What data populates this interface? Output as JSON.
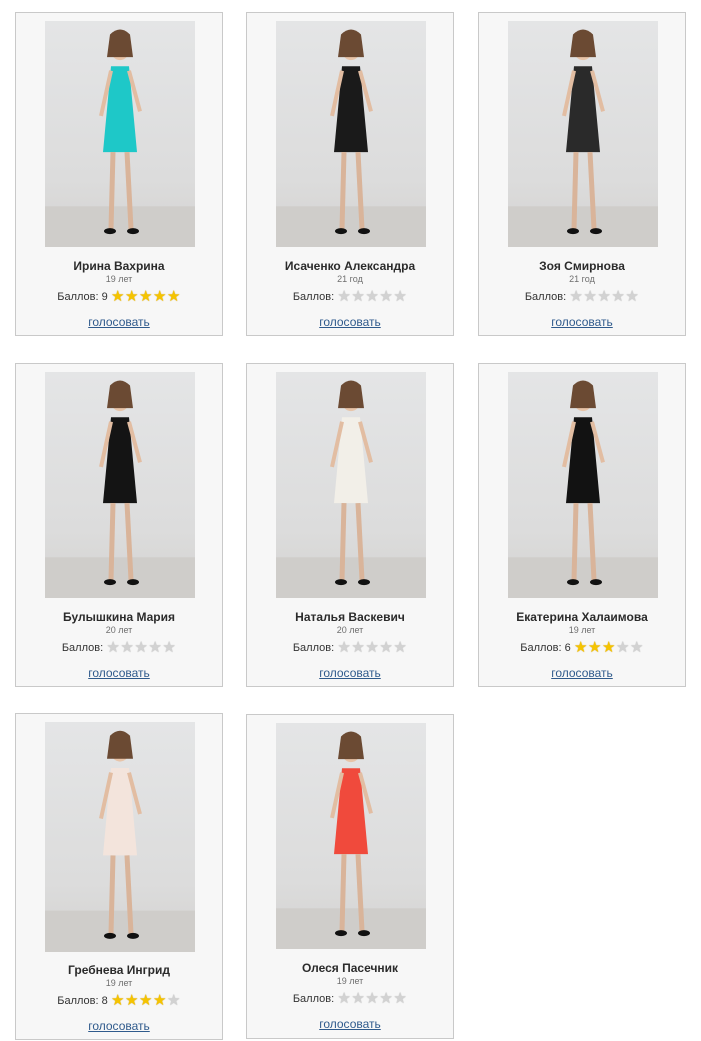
{
  "contestants": [
    {
      "name": "Ирина Вахрина",
      "age": "19 лет",
      "score_label": "Баллов: 9",
      "stars_filled": 5,
      "vote_label": "голосовать",
      "dress_color": "#1ec8c8"
    },
    {
      "name": "Исаченко Александра",
      "age": "21 год",
      "score_label": "Баллов:",
      "stars_filled": 0,
      "vote_label": "голосовать",
      "dress_color": "#1a1a1a"
    },
    {
      "name": "Зоя Смирнова",
      "age": "21 год",
      "score_label": "Баллов:",
      "stars_filled": 0,
      "vote_label": "голосовать",
      "dress_color": "#2a2a2a"
    },
    {
      "name": "Булышкина Мария",
      "age": "20 лет",
      "score_label": "Баллов:",
      "stars_filled": 0,
      "vote_label": "голосовать",
      "dress_color": "#141414"
    },
    {
      "name": "Наталья Васкевич",
      "age": "20 лет",
      "score_label": "Баллов:",
      "stars_filled": 0,
      "vote_label": "голосовать",
      "dress_color": "#f2efe8"
    },
    {
      "name": "Екатерина Халаимова",
      "age": "19 лет",
      "score_label": "Баллов: 6",
      "stars_filled": 3,
      "vote_label": "голосовать",
      "dress_color": "#121212"
    },
    {
      "name": "Гребнева Ингрид",
      "age": "19 лет",
      "score_label": "Баллов: 8",
      "stars_filled": 4,
      "vote_label": "голосовать",
      "dress_color": "#f3e4dc"
    },
    {
      "name": "Олеся Пасечник",
      "age": "19 лет",
      "score_label": "Баллов:",
      "stars_filled": 0,
      "vote_label": "голосовать",
      "dress_color": "#f04a3c"
    }
  ],
  "star_total": 5,
  "colors": {
    "link": "#2f5a8c",
    "star_on": "#f5c400",
    "star_off": "#d2d2d2",
    "card_bg": "#f7f7f7",
    "card_border": "#c9c9c9"
  }
}
